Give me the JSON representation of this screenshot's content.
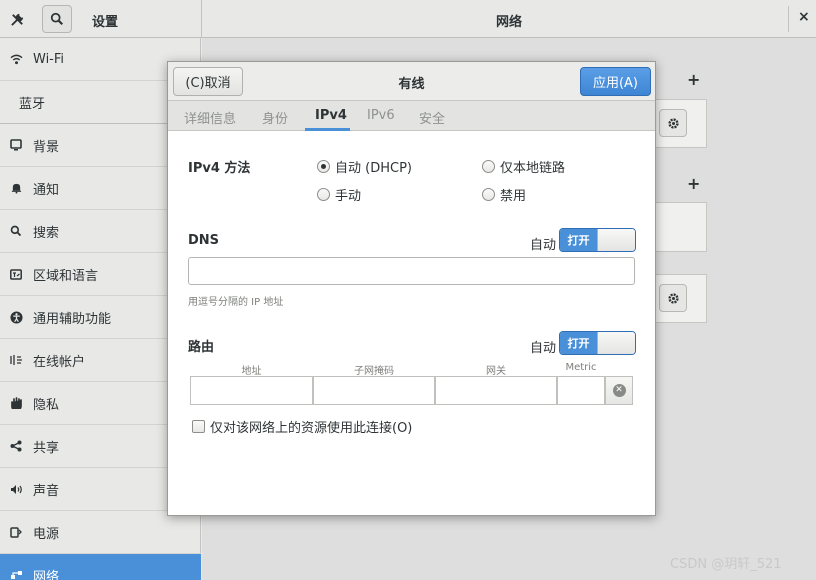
{
  "header": {
    "left_title": "设置",
    "right_title": "网络",
    "close_symbol": "×"
  },
  "sidebar": {
    "items": [
      {
        "label": "Wi-Fi",
        "icon": "wifi-icon"
      },
      {
        "label": "蓝牙",
        "icon": ""
      },
      {
        "label": "背景",
        "icon": "background-icon"
      },
      {
        "label": "通知",
        "icon": "bell-icon"
      },
      {
        "label": "搜索",
        "icon": "search-icon"
      },
      {
        "label": "区域和语言",
        "icon": "region-icon"
      },
      {
        "label": "通用辅助功能",
        "icon": "accessibility-icon"
      },
      {
        "label": "在线帐户",
        "icon": "online-accounts-icon"
      },
      {
        "label": "隐私",
        "icon": "hand-icon"
      },
      {
        "label": "共享",
        "icon": "share-icon"
      },
      {
        "label": "声音",
        "icon": "speaker-icon"
      },
      {
        "label": "电源",
        "icon": "power-icon"
      },
      {
        "label": "网络",
        "icon": "network-icon",
        "active": true
      }
    ]
  },
  "dialog": {
    "cancel_label": "(C)取消",
    "title": "有线",
    "apply_label": "应用(A)",
    "tabs": [
      "详细信息",
      "身份",
      "IPv4",
      "IPv6",
      "安全"
    ],
    "active_tab": "IPv4",
    "ipv4_method_label": "IPv4 方法",
    "methods": {
      "auto": "自动 (DHCP)",
      "link_local": "仅本地链路",
      "manual": "手动",
      "disabled": "禁用"
    },
    "selected_method": "auto",
    "dns": {
      "label": "DNS",
      "auto_label": "自动",
      "switch_label": "打开",
      "value": "",
      "hint": "用逗号分隔的 IP 地址"
    },
    "routes": {
      "label": "路由",
      "auto_label": "自动",
      "switch_label": "打开",
      "columns": [
        "地址",
        "子网掩码",
        "网关",
        "Metric"
      ]
    },
    "only_local_label": "仅对该网络上的资源使用此连接(O)"
  },
  "watermark": "CSDN @玥轩_521"
}
